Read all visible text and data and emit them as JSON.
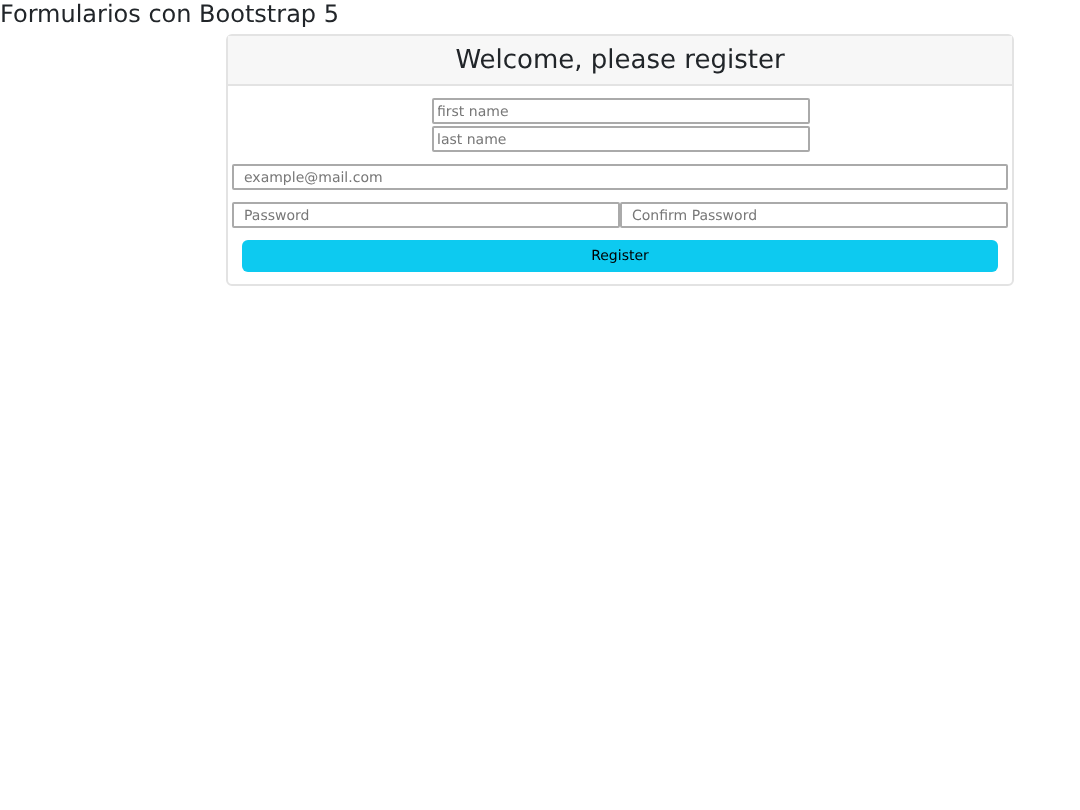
{
  "page_title": "Formularios con Bootstrap 5",
  "card": {
    "title": "Welcome, please register",
    "name_fields": [
      {
        "placeholder": "first name"
      },
      {
        "placeholder": "last name"
      }
    ],
    "email_field": {
      "placeholder": "example@mail.com"
    },
    "password_fields": [
      {
        "placeholder": "Password"
      },
      {
        "placeholder": "Confirm Password"
      }
    ],
    "submit_button": "Register"
  }
}
